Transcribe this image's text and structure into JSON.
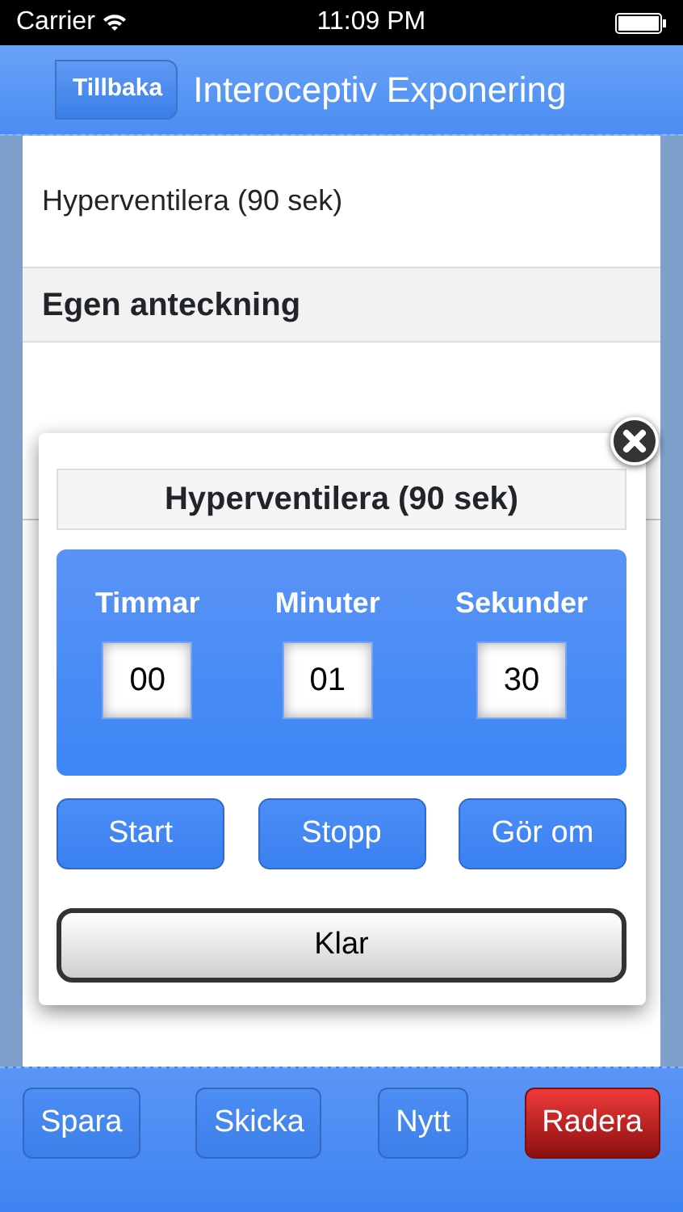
{
  "status_bar": {
    "carrier": "Carrier",
    "time": "11:09 PM"
  },
  "nav": {
    "back": "Tillbaka",
    "title": "Interoceptiv Exponering"
  },
  "list": [
    {
      "kind": "item",
      "text": "Hyperventilera (90 sek)"
    },
    {
      "kind": "header",
      "text": "Egen anteckning"
    }
  ],
  "dialog": {
    "title": "Hyperventilera (90 sek)",
    "timer": [
      {
        "label": "Timmar",
        "value": "00"
      },
      {
        "label": "Minuter",
        "value": "01"
      },
      {
        "label": "Sekunder",
        "value": "30"
      }
    ],
    "buttons": [
      "Start",
      "Stopp",
      "Gör om"
    ],
    "done": "Klar"
  },
  "toolbar": [
    {
      "label": "Spara",
      "kind": "normal"
    },
    {
      "label": "Skicka",
      "kind": "normal"
    },
    {
      "label": "Nytt",
      "kind": "normal"
    },
    {
      "label": "Radera",
      "kind": "danger"
    }
  ]
}
